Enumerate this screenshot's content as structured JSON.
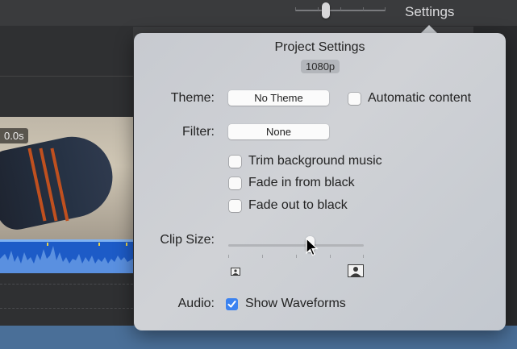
{
  "toolbar": {
    "settings_label": "Settings",
    "zoom_level": 0.34
  },
  "timeline": {
    "time_label": "0.0s"
  },
  "popover": {
    "title": "Project Settings",
    "resolution": "1080p",
    "theme": {
      "label": "Theme:",
      "value": "No Theme",
      "automatic_content": {
        "label": "Automatic content",
        "checked": false
      }
    },
    "filter": {
      "label": "Filter:",
      "value": "None"
    },
    "options": [
      {
        "label": "Trim background music",
        "checked": false
      },
      {
        "label": "Fade in from black",
        "checked": false
      },
      {
        "label": "Fade out to black",
        "checked": false
      }
    ],
    "clip_size": {
      "label": "Clip Size:",
      "value": 0.6,
      "small_icon": "small-frame-icon",
      "large_icon": "large-frame-icon"
    },
    "audio": {
      "label": "Audio:",
      "show_waveforms": {
        "label": "Show Waveforms",
        "checked": true
      }
    }
  },
  "colors": {
    "accent": "#3b82f0",
    "audio_track": "#1d5bc7",
    "popover_bg": "#c8cbd0"
  }
}
